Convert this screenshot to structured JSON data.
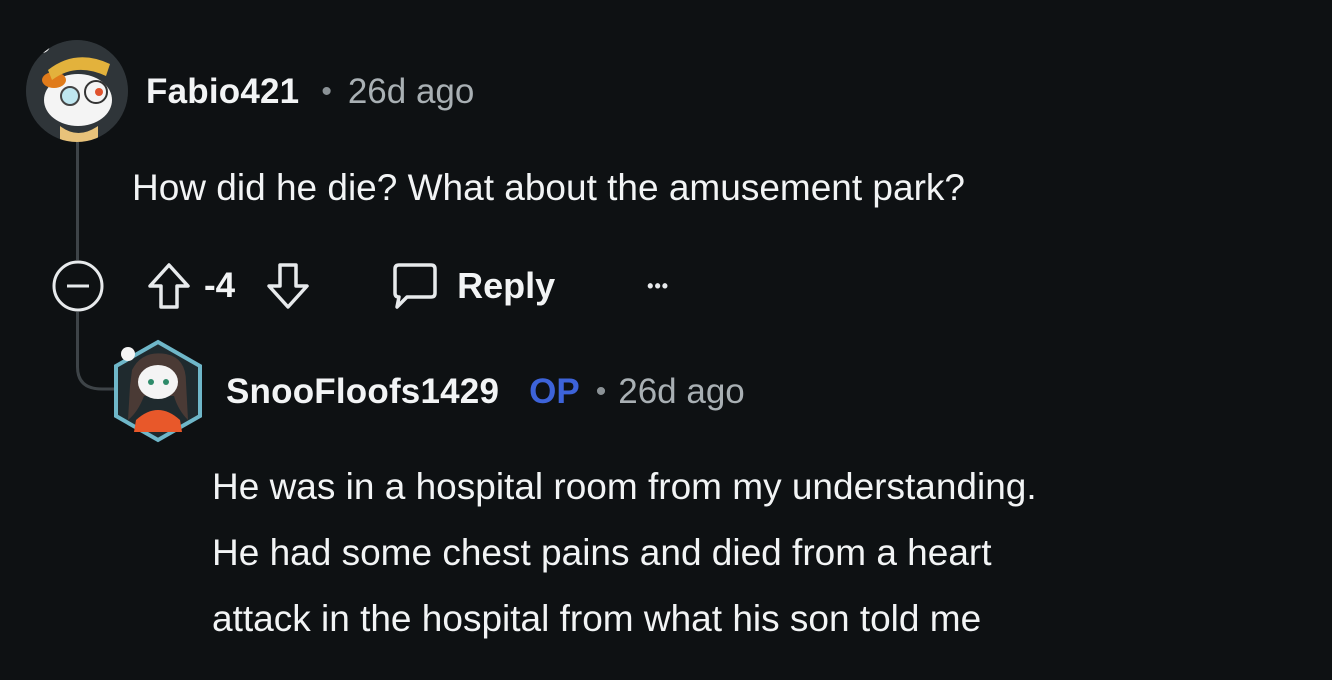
{
  "comments": [
    {
      "username": "Fabio421",
      "separator": "•",
      "time": "26d ago",
      "body": "How did he die? What about the amusement park?",
      "avatar_icon": "snoo-avatar-goggles-icon"
    },
    {
      "username": "SnooFloofs1429",
      "badge": "OP",
      "separator": "•",
      "time": "26d ago",
      "body_lines": [
        "He was in a hospital room from my understanding.",
        "He had some chest pains and died from a heart",
        "attack in the hospital from what his son told me"
      ],
      "avatar_icon": "snoo-avatar-girl-icon"
    }
  ],
  "actions": {
    "collapse_icon": "collapse-minus-icon",
    "upvote_icon": "upvote-arrow-icon",
    "score": "-4",
    "downvote_icon": "downvote-arrow-icon",
    "reply_icon": "speech-bubble-icon",
    "reply_label": "Reply",
    "more_icon": "more-options-icon",
    "more_label": "•••"
  },
  "colors": {
    "background": "#0e1113",
    "thread_line": "#3e4448",
    "op_badge": "#3d63d9",
    "text": "#f2f4f5",
    "muted": "#a9b0b4"
  }
}
